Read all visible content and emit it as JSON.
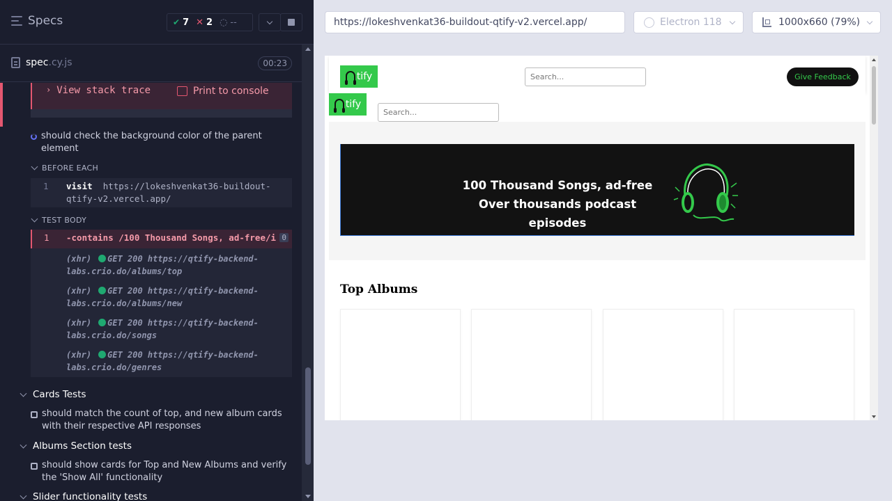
{
  "reporter": {
    "title": "Specs",
    "stats": {
      "passed": "7",
      "failed": "2",
      "pending": "--"
    },
    "spec": {
      "name": "spec",
      "ext": ".cy.js",
      "time": "00:23"
    },
    "stack": {
      "view_label": "View stack trace",
      "print_label": "Print to console"
    },
    "current_test": "should check the background color of the parent element",
    "before_each": {
      "label": "BEFORE EACH",
      "command": {
        "num": "1",
        "name": "visit",
        "url": "https://lokeshvenkat36-buildout-qtify-v2.vercel.app/"
      }
    },
    "test_body": {
      "label": "TEST BODY",
      "failed_command": {
        "num": "1",
        "text": "-contains  /100 Thousand Songs, ad-free/i",
        "count": "0"
      },
      "xhr": [
        {
          "type": "(xhr)",
          "text": "GET 200 https://qtify-backend-labs.crio.do/albums/top"
        },
        {
          "type": "(xhr)",
          "text": "GET 200 https://qtify-backend-labs.crio.do/albums/new"
        },
        {
          "type": "(xhr)",
          "text": "GET 200 https://qtify-backend-labs.crio.do/songs"
        },
        {
          "type": "(xhr)",
          "text": "GET 200 https://qtify-backend-labs.crio.do/genres"
        }
      ]
    },
    "suites": [
      {
        "title": "Cards Tests",
        "test": "should match the count of top, and new album cards with their respective API responses"
      },
      {
        "title": "Albums Section tests",
        "test": "should show cards for Top and New Albums and verify the 'Show All' functionality"
      },
      {
        "title": "Slider functionality tests"
      }
    ]
  },
  "preview": {
    "url": "https://lokeshvenkat36-buildout-qtify-v2.vercel.app/",
    "browser": "Electron 118",
    "viewport": "1000x660  (79%)",
    "app": {
      "logo_text": "tify",
      "search_placeholder": "Search...",
      "feedback_label": "Give Feedback",
      "hero_line1": "100 Thousand Songs, ad-free",
      "hero_line2": "Over thousands podcast episodes",
      "section_title": "Top Albums"
    }
  },
  "colors": {
    "pass": "#1fa971",
    "fail": "#e45770",
    "brand_green": "#34c94b",
    "reporter_bg": "#1b1e2e"
  }
}
